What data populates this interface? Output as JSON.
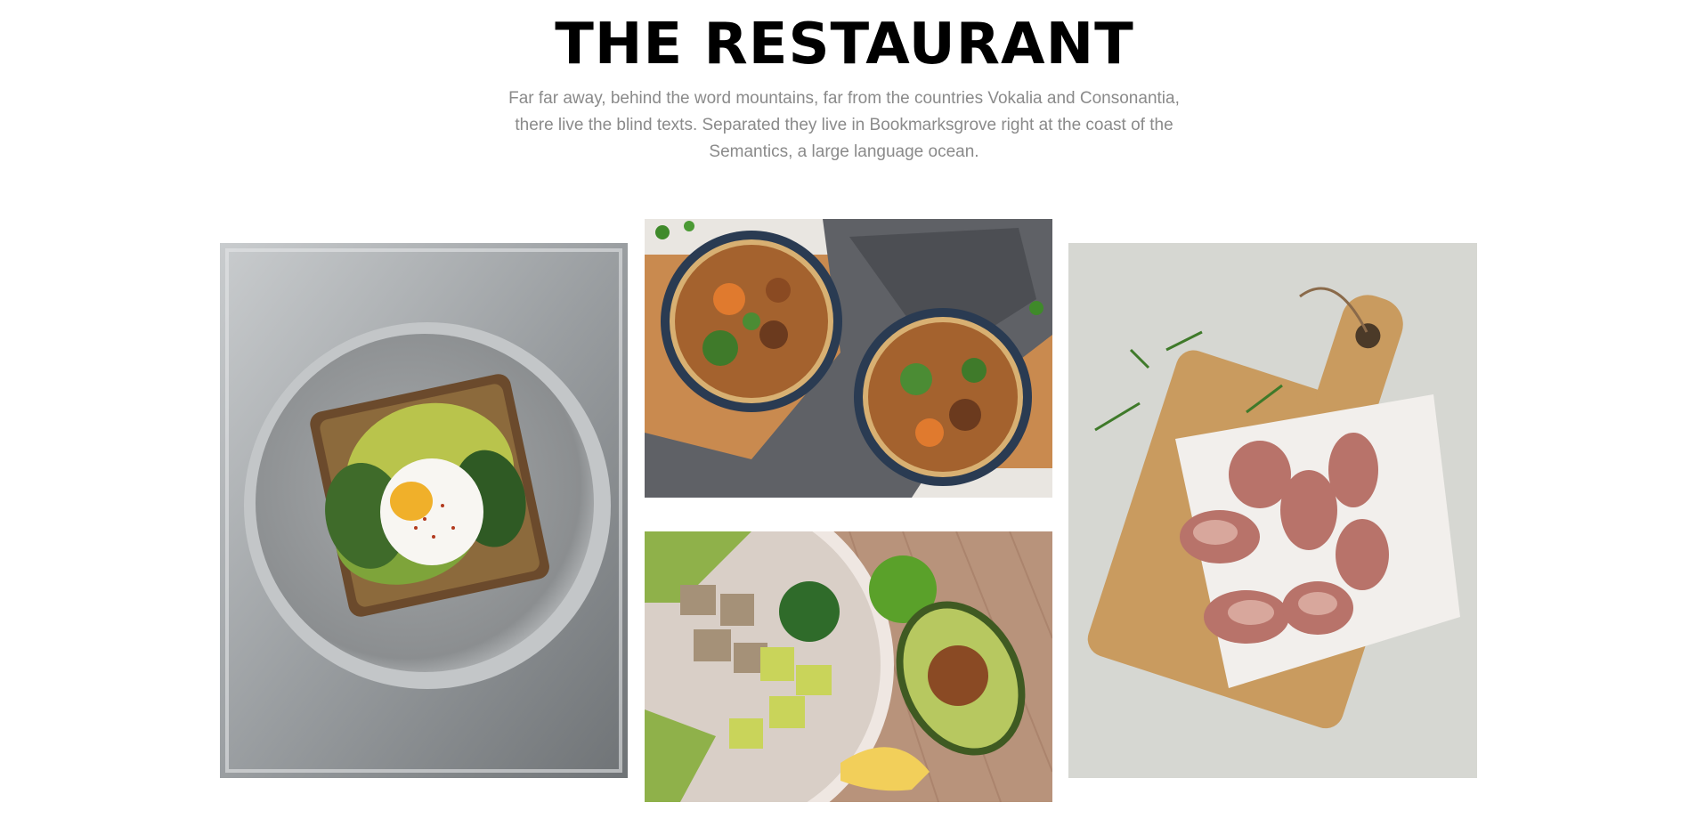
{
  "header": {
    "title": "THE RESTAURANT",
    "lead": "Far far away, behind the word mountains, far from the countries Vokalia and Consonantia, there live the blind texts. Separated they live in Bookmarksgrove right at the coast of the Semantics, a large language ocean."
  },
  "colors": {
    "title": "#000000",
    "lead_text": "#8a8a8a",
    "background": "#ffffff"
  },
  "gallery": {
    "images": [
      {
        "name": "avocado-egg-toast-photo"
      },
      {
        "name": "noodle-soup-bowls-photo"
      },
      {
        "name": "avocado-tofu-bowl-photo"
      },
      {
        "name": "bacon-wrapped-skewers-photo"
      }
    ]
  }
}
